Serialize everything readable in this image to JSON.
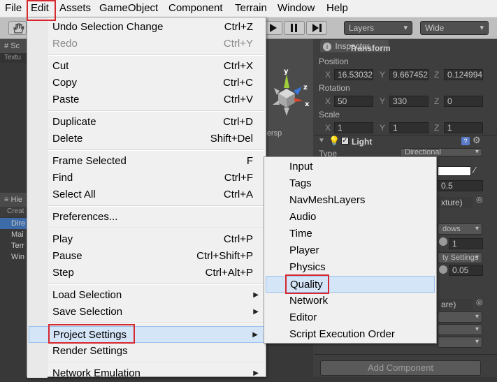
{
  "menubar": {
    "items": [
      "File",
      "Edit",
      "Assets",
      "GameObject",
      "Component",
      "Terrain",
      "Window",
      "Help"
    ]
  },
  "toolbar": {
    "layers_label": "Layers",
    "layout_label": "Wide"
  },
  "scene": {
    "tab_label": "Sc",
    "sub_label": "Textu",
    "persp_label": "< Persp",
    "gizmo_axes": [
      "y",
      "z",
      "x"
    ]
  },
  "hierarchy": {
    "tab_label": "Hie",
    "create_label": "Creat",
    "rows": [
      "Dire",
      "Mai",
      "Terr",
      "Win"
    ]
  },
  "inspector": {
    "tab_label": "Inspector",
    "transform_title": "Transform",
    "position_label": "Position",
    "position": {
      "x": "16.53032",
      "y": "9.667452",
      "z": "0.124994"
    },
    "rotation_label": "Rotation",
    "rotation": {
      "x": "50",
      "y": "330",
      "z": "0"
    },
    "scale_label": "Scale",
    "scale": {
      "x": "1",
      "y": "1",
      "z": "1"
    },
    "axis_x": "X",
    "axis_y": "Y",
    "axis_z": "Z",
    "light_title": "Light",
    "type_label": "Type",
    "type_value": "Directional",
    "intensity_value": "0.5",
    "cookie_value": "xture)",
    "shadows_value": "dows",
    "shadow_strength": "1",
    "quality_settings": "ty Settings",
    "bias_value": "0.05",
    "flare_value": "are)",
    "add_component": "Add Component"
  },
  "edit_menu": {
    "items": [
      {
        "label": "Undo Selection Change",
        "shortcut": "Ctrl+Z"
      },
      {
        "label": "Redo",
        "shortcut": "Ctrl+Y"
      },
      {
        "label": "Cut",
        "shortcut": "Ctrl+X"
      },
      {
        "label": "Copy",
        "shortcut": "Ctrl+C"
      },
      {
        "label": "Paste",
        "shortcut": "Ctrl+V"
      },
      {
        "label": "Duplicate",
        "shortcut": "Ctrl+D"
      },
      {
        "label": "Delete",
        "shortcut": "Shift+Del"
      },
      {
        "label": "Frame Selected",
        "shortcut": "F"
      },
      {
        "label": "Find",
        "shortcut": "Ctrl+F"
      },
      {
        "label": "Select All",
        "shortcut": "Ctrl+A"
      },
      {
        "label": "Preferences...",
        "shortcut": ""
      },
      {
        "label": "Play",
        "shortcut": "Ctrl+P"
      },
      {
        "label": "Pause",
        "shortcut": "Ctrl+Shift+P"
      },
      {
        "label": "Step",
        "shortcut": "Ctrl+Alt+P"
      },
      {
        "label": "Load Selection",
        "shortcut": ""
      },
      {
        "label": "Save Selection",
        "shortcut": ""
      },
      {
        "label": "Project Settings",
        "shortcut": ""
      },
      {
        "label": "Render Settings",
        "shortcut": ""
      },
      {
        "label": "Network Emulation",
        "shortcut": ""
      }
    ]
  },
  "project_settings_submenu": {
    "items": [
      "Input",
      "Tags",
      "NavMeshLayers",
      "Audio",
      "Time",
      "Player",
      "Physics",
      "Quality",
      "Network",
      "Editor",
      "Script Execution Order"
    ]
  },
  "colors": {
    "highlight_box": "#d6282e",
    "menu_bg": "#f0f0f0",
    "hover_bg": "#d5e5f8",
    "editor_dark": "#383838"
  }
}
